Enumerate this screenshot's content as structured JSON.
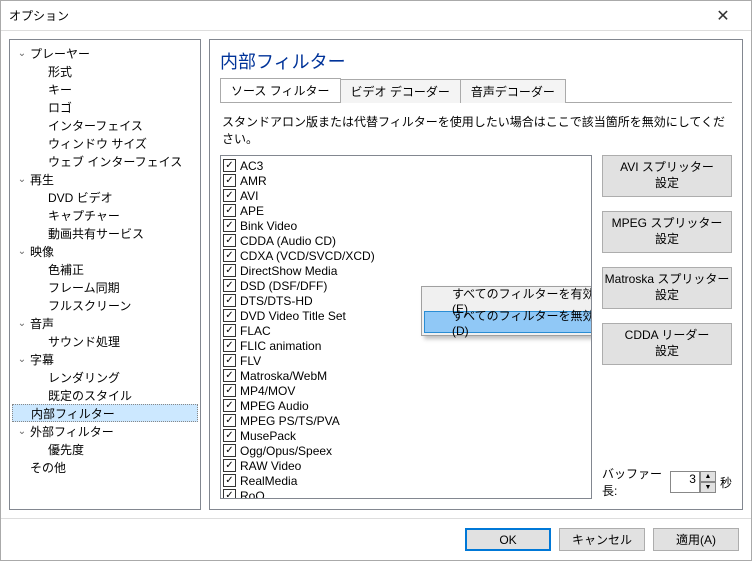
{
  "title": "オプション",
  "tree": [
    {
      "d": 0,
      "e": "v",
      "t": "プレーヤー"
    },
    {
      "d": 1,
      "e": "",
      "t": "形式"
    },
    {
      "d": 1,
      "e": "",
      "t": "キー"
    },
    {
      "d": 1,
      "e": "",
      "t": "ロゴ"
    },
    {
      "d": 1,
      "e": "",
      "t": "インターフェイス"
    },
    {
      "d": 1,
      "e": "",
      "t": "ウィンドウ サイズ"
    },
    {
      "d": 1,
      "e": "",
      "t": "ウェブ インターフェイス"
    },
    {
      "d": 0,
      "e": "v",
      "t": "再生"
    },
    {
      "d": 1,
      "e": "",
      "t": "DVD ビデオ"
    },
    {
      "d": 1,
      "e": "",
      "t": "キャプチャー"
    },
    {
      "d": 1,
      "e": "",
      "t": "動画共有サービス"
    },
    {
      "d": 0,
      "e": "v",
      "t": "映像"
    },
    {
      "d": 1,
      "e": "",
      "t": "色補正"
    },
    {
      "d": 1,
      "e": "",
      "t": "フレーム同期"
    },
    {
      "d": 1,
      "e": "",
      "t": "フルスクリーン"
    },
    {
      "d": 0,
      "e": "v",
      "t": "音声"
    },
    {
      "d": 1,
      "e": "",
      "t": "サウンド処理"
    },
    {
      "d": 0,
      "e": "v",
      "t": "字幕"
    },
    {
      "d": 1,
      "e": "",
      "t": "レンダリング"
    },
    {
      "d": 1,
      "e": "",
      "t": "既定のスタイル"
    },
    {
      "d": 0,
      "e": "",
      "t": "内部フィルター",
      "sel": true
    },
    {
      "d": 0,
      "e": "v",
      "t": "外部フィルター"
    },
    {
      "d": 1,
      "e": "",
      "t": "優先度"
    },
    {
      "d": 0,
      "e": "",
      "t": "その他"
    }
  ],
  "content_title": "内部フィルター",
  "tabs": [
    "ソース フィルター",
    "ビデオ デコーダー",
    "音声デコーダー"
  ],
  "desc": "スタンドアロン版または代替フィルターを使用したい場合はここで該当箇所を無効にしてください。",
  "filters": [
    "AC3",
    "AMR",
    "AVI",
    "APE",
    "Bink Video",
    "CDDA (Audio CD)",
    "CDXA (VCD/SVCD/XCD)",
    "DirectShow Media",
    "DSD (DSF/DFF)",
    "DTS/DTS-HD",
    "DVD Video Title Set",
    "FLAC",
    "FLIC animation",
    "FLV",
    "Matroska/WebM",
    "MP4/MOV",
    "MPEG Audio",
    "MPEG PS/TS/PVA",
    "MusePack",
    "Ogg/Opus/Speex",
    "RAW Video",
    "RealMedia",
    "RoQ"
  ],
  "side_buttons": [
    "AVI スプリッター\n設定",
    "MPEG スプリッター\n設定",
    "Matroska スプリッター\n設定",
    "CDDA リーダー\n設定"
  ],
  "buffer_label": "バッファー長:",
  "buffer_value": "3",
  "buffer_unit": "秒",
  "ctx": [
    "すべてのフィルターを有効にする(E)",
    "すべてのフィルターを無効にする(D)"
  ],
  "buttons": {
    "ok": "OK",
    "cancel": "キャンセル",
    "apply": "適用(A)"
  }
}
